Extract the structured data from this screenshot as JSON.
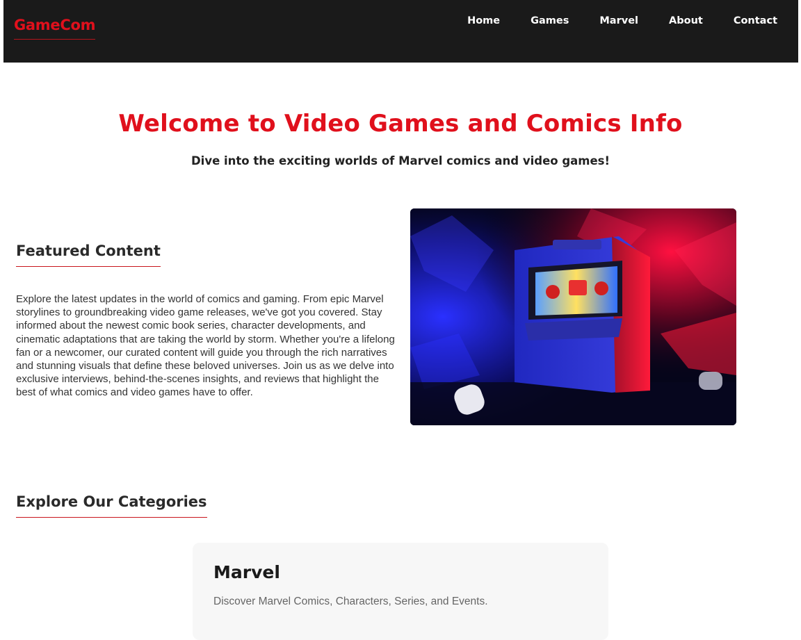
{
  "header": {
    "logo": "GameCom",
    "nav": [
      "Home",
      "Games",
      "Marvel",
      "About",
      "Contact"
    ]
  },
  "hero": {
    "title": "Welcome to Video Games and Comics Info",
    "subtitle": "Dive into the exciting worlds of Marvel comics and video games!"
  },
  "featured": {
    "heading": "Featured Content",
    "text": "Explore the latest updates in the world of comics and gaming. From epic Marvel storylines to groundbreaking video game releases, we've got you covered. Stay informed about the newest comic book series, character developments, and cinematic adaptations that are taking the world by storm. Whether you're a lifelong fan or a newcomer, our curated content will guide you through the rich narratives and stunning visuals that define these beloved universes. Join us as we delve into exclusive interviews, behind-the-scenes insights, and reviews that highlight the best of what comics and video games have to offer."
  },
  "categories": {
    "heading": "Explore Our Categories",
    "items": [
      {
        "title": "Marvel",
        "description": "Discover Marvel Comics, Characters, Series, and Events."
      }
    ]
  },
  "colors": {
    "accent": "#e0101c",
    "header_bg": "#1a1a1a",
    "card_bg": "#f7f7f7"
  }
}
